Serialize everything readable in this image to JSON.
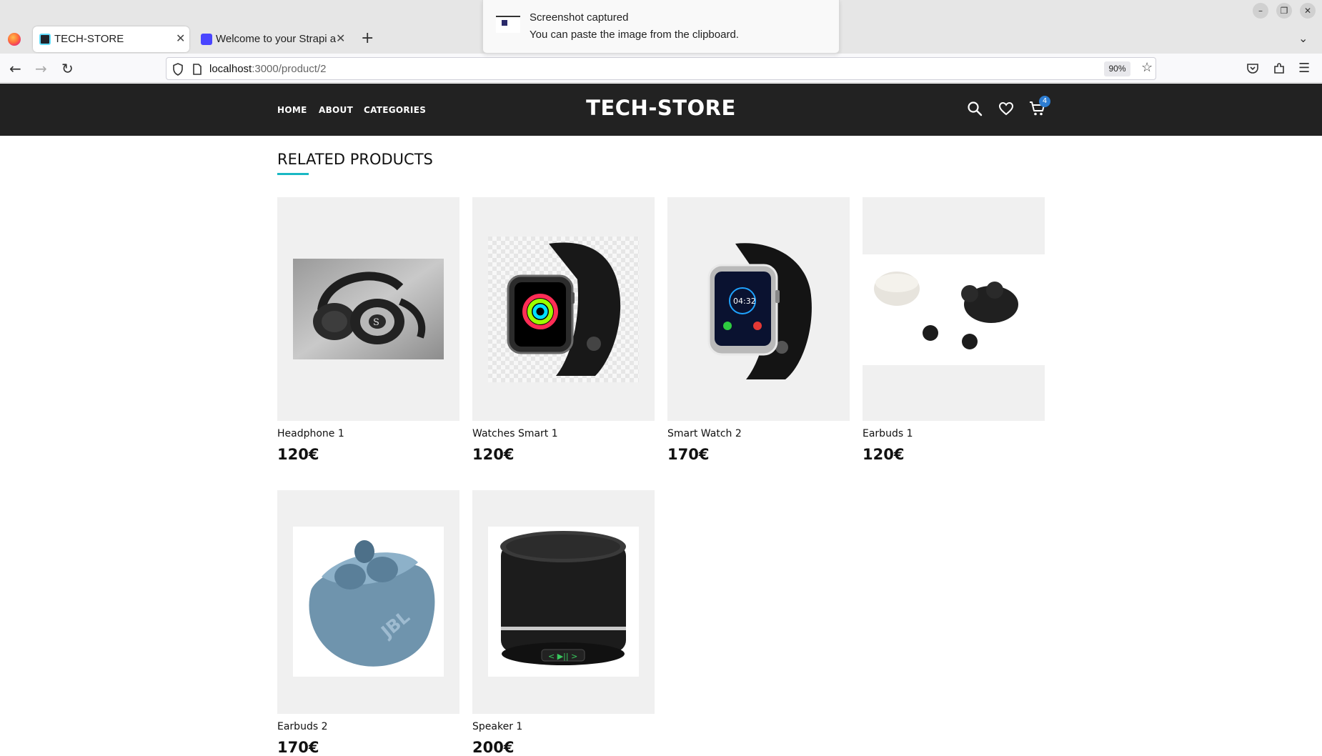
{
  "browser": {
    "tabs": [
      {
        "title": "TECH-STORE",
        "active": true
      },
      {
        "title": "Welcome to your Strapi a",
        "active": false
      }
    ],
    "url_host": "localhost",
    "url_path": ":3000/product/2",
    "zoom": "90%"
  },
  "notification": {
    "title": "Screenshot captured",
    "body": "You can paste the image from the clipboard."
  },
  "site": {
    "brand": "TECH-STORE",
    "menu": [
      "HOME",
      "ABOUT",
      "CATEGORIES"
    ],
    "cart_count": "4",
    "accent_color": "#19b8c4",
    "header_color": "#222222"
  },
  "related": {
    "title": "RELATED PRODUCTS",
    "products": [
      {
        "name": "Headphone 1",
        "price": "120€",
        "image": "headphones"
      },
      {
        "name": "Watches Smart 1",
        "price": "120€",
        "image": "smartwatch-black"
      },
      {
        "name": "Smart Watch 2",
        "price": "170€",
        "image": "smartwatch-silver"
      },
      {
        "name": "Earbuds 1",
        "price": "120€",
        "image": "earbuds-case-white"
      },
      {
        "name": "Earbuds 2",
        "price": "170€",
        "image": "earbuds-case-blue"
      },
      {
        "name": "Speaker 1",
        "price": "200€",
        "image": "speaker"
      }
    ]
  }
}
